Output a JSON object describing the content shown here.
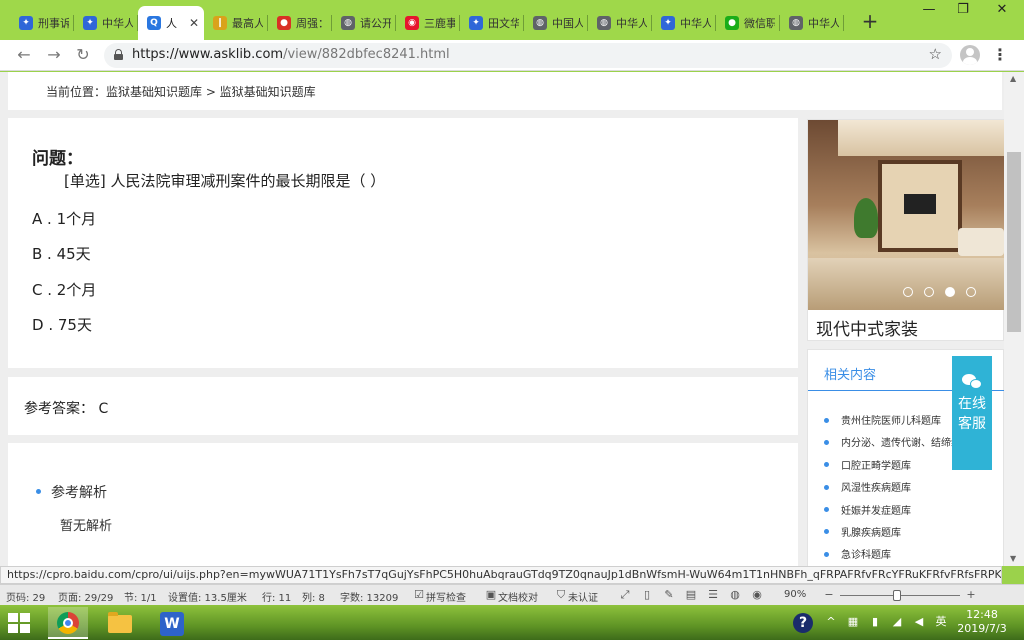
{
  "browser": {
    "tabs": [
      {
        "label": "刑事诉",
        "icon": "paw-icon",
        "color": "#2f67d8",
        "glyph": "✦"
      },
      {
        "label": "中华人",
        "icon": "paw-icon",
        "color": "#2f67d8",
        "glyph": "✦"
      },
      {
        "label": "人",
        "icon": "asklib-icon",
        "color": "#2a77e0",
        "glyph": "Q",
        "active": true
      },
      {
        "label": "最高人",
        "icon": "document-icon",
        "color": "#d9a21b",
        "glyph": "❙"
      },
      {
        "label": "周强：",
        "icon": "emblem-icon",
        "color": "#d93025",
        "glyph": "●"
      },
      {
        "label": "请公开",
        "icon": "globe-icon",
        "color": "#5f6368",
        "glyph": "◍"
      },
      {
        "label": "三鹿事",
        "icon": "weibo-icon",
        "color": "#e6162d",
        "glyph": "◉"
      },
      {
        "label": "田文华",
        "icon": "paw-icon",
        "color": "#2f67d8",
        "glyph": "✦"
      },
      {
        "label": "中国人",
        "icon": "globe-icon",
        "color": "#5f6368",
        "glyph": "◍"
      },
      {
        "label": "中华人",
        "icon": "globe-icon",
        "color": "#5f6368",
        "glyph": "◍"
      },
      {
        "label": "中华人",
        "icon": "paw-icon",
        "color": "#2f67d8",
        "glyph": "✦"
      },
      {
        "label": "微信职",
        "icon": "wechat-icon",
        "color": "#1aad19",
        "glyph": "●"
      },
      {
        "label": "中华人",
        "icon": "globe-icon",
        "color": "#5f6368",
        "glyph": "◍"
      }
    ],
    "url_main": "https://www.asklib.com",
    "url_path": "/view/882dbfec8241.html",
    "status_url": "https://cpro.baidu.com/cpro/ui/uijs.php?en=mywWUA71T1YsFh7sT7qGujYsFhPC5H0huAbqrauGTdq9TZ0qnauJp1dBnWfsmH-WuW64m1T1nHNBFh_qFRPAFRfvFRcYFRuKFRfvFRfsFRPKFRFDFR..."
  },
  "page": {
    "breadcrumb": "当前位置：监狱基础知识题库 > 监狱基础知识题库",
    "question_label": "问题：",
    "question_text": "[单选] 人民法院审理减刑案件的最长期限是（ ）",
    "options": [
      "A . 1个月",
      "B . 45天",
      "C . 2个月",
      "D . 75天"
    ],
    "answer": "参考答案： C",
    "analysis_title": "参考解析",
    "analysis_text": "暂无解析",
    "ad_caption": "现代中式家装",
    "carousel_active": 3,
    "related_title": "相关内容",
    "related_items": [
      "贵州住院医师儿科题库",
      "内分泌、遗传代谢、结缔组织和免",
      "口腔正畸学题库",
      "风湿性疾病题库",
      "妊娠并发症题库",
      "乳腺疾病题库",
      "急诊科题库"
    ],
    "service_label": "在线客服"
  },
  "wordbar": {
    "page": "页码: 29",
    "pages": "页面: 29/29",
    "section": "节: 1/1",
    "setting": "设置值: 13.5厘米",
    "row": "行: 11",
    "col": "列: 8",
    "words": "字数: 13209",
    "spell": "拼写检查",
    "proof": "文档校对",
    "cert": "未认证",
    "zoom": "90%"
  },
  "taskbar": {
    "time": "12:48",
    "date": "2019/7/3",
    "lang": "英"
  }
}
